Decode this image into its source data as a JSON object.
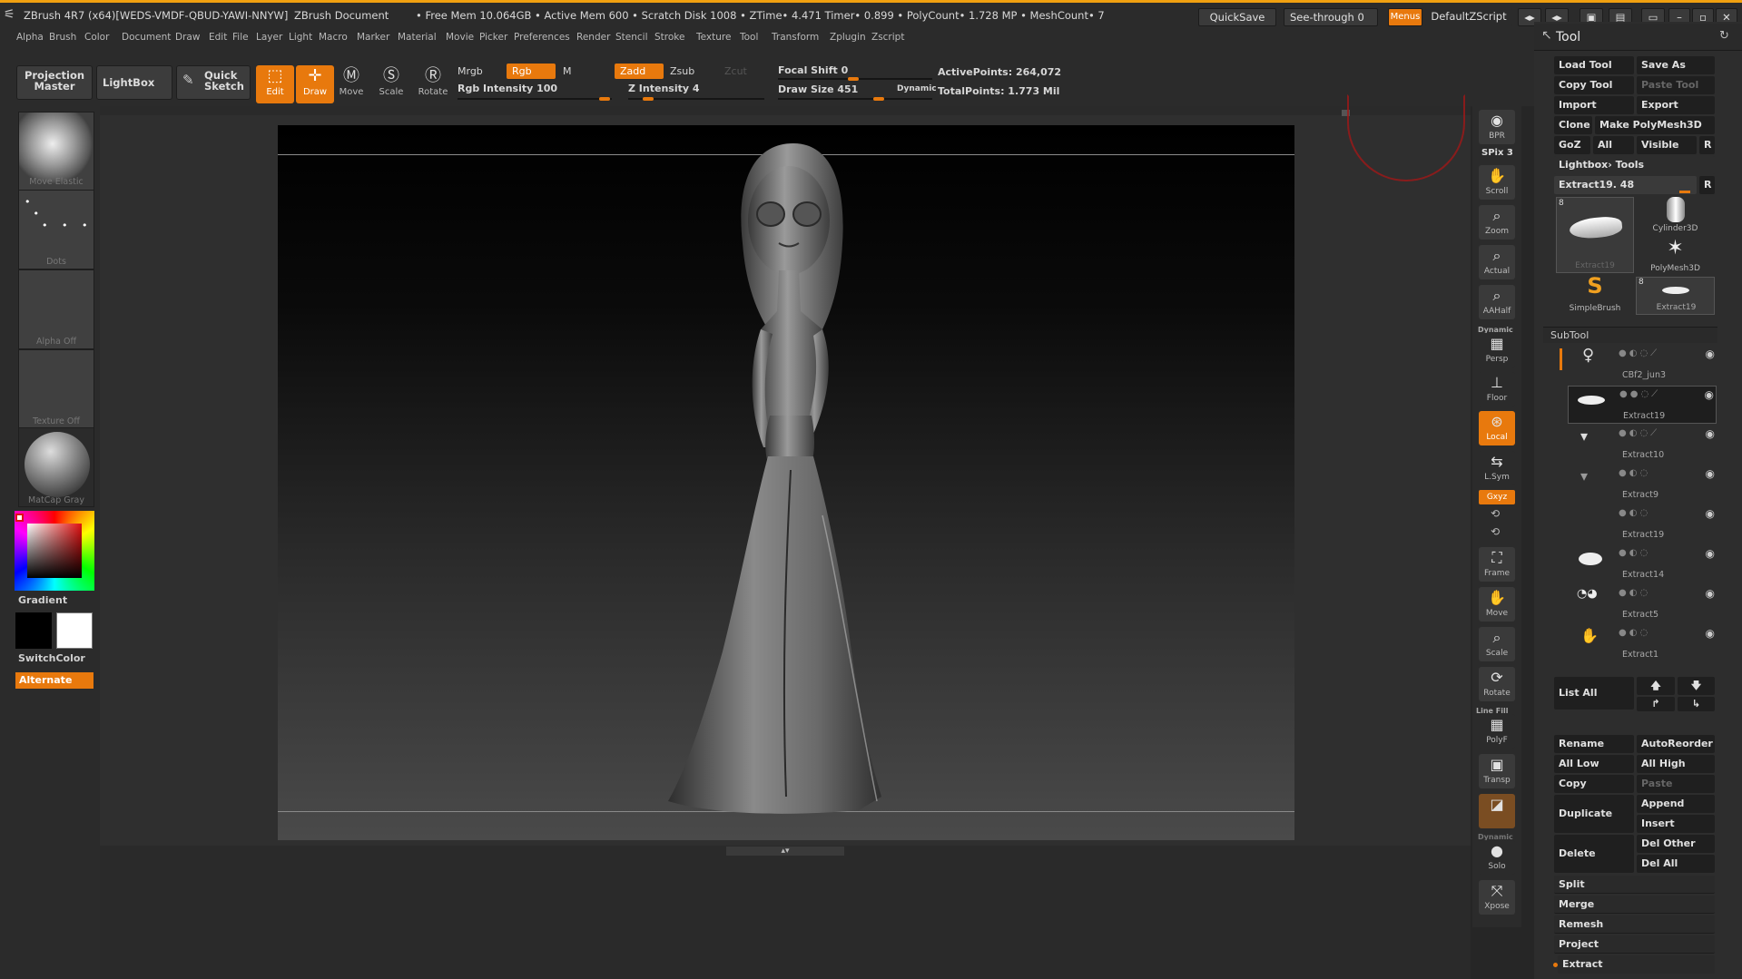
{
  "status_bar": {
    "app_title": "ZBrush 4R7 (x64)[WEDS-VMDF-QBUD-YAWI-NNYW]",
    "document": "ZBrush Document",
    "stats": "• Free Mem 10.064GB • Active Mem 600 • Scratch Disk 1008 • ZTime• 4.471 Timer• 0.899 • PolyCount• 1.728 MP • MeshCount• 7",
    "quicksave": "QuickSave",
    "see_through": "See-through 0",
    "menus": "Menus",
    "script": "DefaultZScript"
  },
  "menubar": [
    "Alpha",
    "Brush",
    "Color",
    "Document",
    "Draw",
    "Edit",
    "File",
    "Layer",
    "Light",
    "Macro",
    "Marker",
    "Material",
    "Movie",
    "Picker",
    "Preferences",
    "Render",
    "Stencil",
    "Stroke",
    "Texture",
    "Tool",
    "Transform",
    "Zplugin",
    "Zscript"
  ],
  "shelf": {
    "projection_master": "Projection Master",
    "lightbox": "LightBox",
    "quick_sketch": "Quick Sketch",
    "edit": "Edit",
    "draw": "Draw",
    "move": "Move",
    "scale": "Scale",
    "rotate": "Rotate",
    "mrgb": "Mrgb",
    "rgb": "Rgb",
    "m": "M",
    "zadd": "Zadd",
    "zsub": "Zsub",
    "zcut": "Zcut",
    "rgb_intensity": "Rgb Intensity 100",
    "z_intensity": "Z Intensity 4",
    "focal_shift": "Focal Shift 0",
    "draw_size": "Draw Size 451",
    "dynamic": "Dynamic",
    "active_points": "ActivePoints: 264,072",
    "total_points": "TotalPoints: 1.773 Mil"
  },
  "left_panel": {
    "brush": "Move Elastic",
    "stroke": "Dots",
    "alpha": "Alpha Off",
    "texture": "Texture Off",
    "material": "MatCap Gray",
    "gradient": "Gradient",
    "switch_color": "SwitchColor",
    "alternate": "Alternate"
  },
  "right_tools": [
    {
      "name": "bpr",
      "label": "BPR",
      "icon": "◉"
    },
    {
      "name": "scroll",
      "label": "Scroll",
      "icon": "✋"
    },
    {
      "name": "zoom",
      "label": "Zoom",
      "icon": "⌕"
    },
    {
      "name": "actual",
      "label": "Actual",
      "icon": "⌕"
    },
    {
      "name": "aahalf",
      "label": "AAHalf",
      "icon": "⌕"
    },
    {
      "name": "persp",
      "label": "Persp",
      "icon": "▦"
    },
    {
      "name": "floor",
      "label": "Floor",
      "icon": "⊥"
    },
    {
      "name": "local",
      "label": "Local",
      "icon": "⊛"
    },
    {
      "name": "lsym",
      "label": "L.Sym",
      "icon": "⇆"
    },
    {
      "name": "frame",
      "label": "Frame",
      "icon": "⛶"
    },
    {
      "name": "move",
      "label": "Move",
      "icon": "✋"
    },
    {
      "name": "scale",
      "label": "Scale",
      "icon": "⌕"
    },
    {
      "name": "rotate",
      "label": "Rotate",
      "icon": "⟳"
    },
    {
      "name": "polyf",
      "label": "PolyF",
      "icon": "▦"
    },
    {
      "name": "transp",
      "label": "Transp",
      "icon": "▣"
    },
    {
      "name": "ghost",
      "label": "",
      "icon": "◪"
    },
    {
      "name": "solo",
      "label": "Solo",
      "icon": "●"
    },
    {
      "name": "xpose",
      "label": "Xpose",
      "icon": "⤧"
    }
  ],
  "right_tool_misc": {
    "spix": "SPix 3",
    "dynamic": "Dynamic",
    "xyz": "Gxyz",
    "line_fill": "Line Fill"
  },
  "tool_panel": {
    "title": "Tool",
    "load_tool": "Load Tool",
    "save_as": "Save As",
    "copy_tool": "Copy Tool",
    "paste_tool": "Paste Tool",
    "import": "Import",
    "export": "Export",
    "clone": "Clone",
    "make_polymesh": "Make PolyMesh3D",
    "goz": "GoZ",
    "all": "All",
    "visible": "Visible",
    "r": "R",
    "lightbox_tools": "Lightbox› Tools",
    "current_tool": "Extract19. 48",
    "thumb_main": "Extract19",
    "thumb_cylinder": "Cylinder3D",
    "thumb_polymesh": "PolyMesh3D",
    "thumb_simplebrush": "SimpleBrush",
    "thumb_extract": "Extract19",
    "thumb_count": "8",
    "subtool_title": "SubTool",
    "subtools": [
      "CBf2_jun3",
      "Extract19",
      "Extract10",
      "Extract9",
      "Extract19",
      "Extract14",
      "Extract5",
      "Extract1"
    ],
    "list_all": "List All",
    "rename": "Rename",
    "autoreorder": "AutoReorder",
    "all_low": "All Low",
    "all_high": "All High",
    "copy": "Copy",
    "paste": "Paste",
    "duplicate": "Duplicate",
    "append": "Append",
    "insert": "Insert",
    "delete": "Delete",
    "del_other": "Del Other",
    "del_all": "Del All",
    "split": "Split",
    "merge": "Merge",
    "remesh": "Remesh",
    "project": "Project",
    "extract": "Extract"
  },
  "colors": {
    "accent": "#e8790d",
    "panel": "#2b2b2b",
    "button": "#1f1f1f"
  }
}
